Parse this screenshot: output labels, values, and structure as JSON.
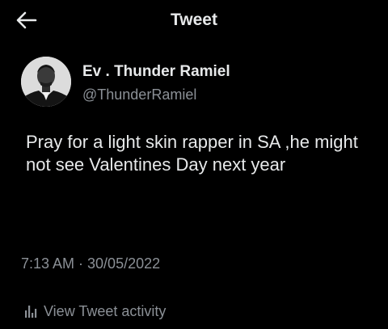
{
  "header": {
    "title": "Tweet",
    "back_icon": "arrow-left-icon"
  },
  "author": {
    "display_name": "Ev . Thunder Ramiel",
    "handle": "@ThunderRamiel"
  },
  "tweet": {
    "text": "Pray for a light skin rapper in SA ,he might not see Valentines Day next year",
    "timestamp": "7:13 AM · 30/05/2022"
  },
  "actions": {
    "activity_label": "View Tweet activity",
    "activity_icon": "bar-chart-icon"
  },
  "colors": {
    "background": "#000000",
    "primary_text": "#e7e9ea",
    "secondary_text": "#8b9096"
  }
}
